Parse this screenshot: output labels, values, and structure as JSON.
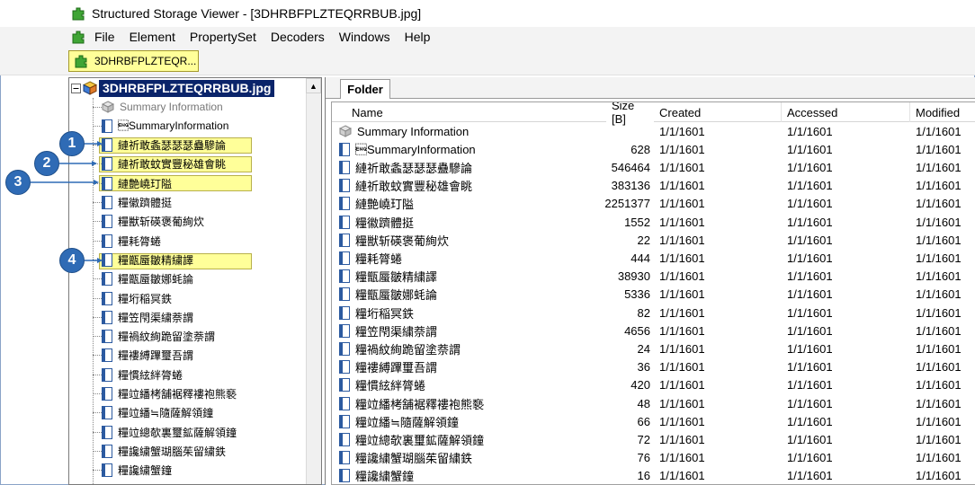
{
  "window": {
    "title": "Structured Storage Viewer - [3DHRBFPLZTEQRRBUB.jpg]"
  },
  "menu": [
    "File",
    "Element",
    "PropertySet",
    "Decoders",
    "Windows",
    "Help"
  ],
  "toolbar": {
    "tree_tab_label": "3DHRBFPLZTEQR..."
  },
  "tree": {
    "root_label": "3DHRBFPLZTEQRRBUB.jpg",
    "items": [
      {
        "label": "Summary Information",
        "gray": true
      },
      {
        "label": "\u0005SummaryInformation",
        "gray": false
      },
      {
        "label": "縺祈敢螽瑟瑟瑟蠱驂論",
        "gray": false
      },
      {
        "label": "縺祈敢蚊實豐秘雄會眺",
        "gray": false
      },
      {
        "label": "縺艶嶢玎隘",
        "gray": false
      },
      {
        "label": "糧徽躋體挺",
        "gray": false
      },
      {
        "label": "糧獣斩碤褒葡絢炊",
        "gray": false
      },
      {
        "label": "糧耗膂蜷",
        "gray": false
      },
      {
        "label": "糧甑蜃皺精繍譯",
        "gray": false
      },
      {
        "label": "糧甑蜃皺娜蚝論",
        "gray": false
      },
      {
        "label": "糧垳稲冥鉄",
        "gray": false
      },
      {
        "label": "糧笠閇渠繍萘謂",
        "gray": false
      },
      {
        "label": "糧禍紋絢跪留塗萘謂",
        "gray": false
      },
      {
        "label": "糧褸縛蹕璽吾謂",
        "gray": false
      },
      {
        "label": "糧慣絃絆膂蜷",
        "gray": false
      },
      {
        "label": "糧竝繙栲舗裾釋褸袍熊褻",
        "gray": false
      },
      {
        "label": "糧竝繙≒隨薩解領鐘",
        "gray": false
      },
      {
        "label": "糧竝總欹裏璽鉱薩解領鐘",
        "gray": false
      },
      {
        "label": "糧讒繍蟹瑚腦茱留繍鉄",
        "gray": false
      },
      {
        "label": "糧讒繍蟹鐘",
        "gray": false
      }
    ]
  },
  "callouts": [
    "1",
    "2",
    "3",
    "4"
  ],
  "right": {
    "tab_label": "Folder",
    "columns": [
      "Name",
      "Size [B]",
      "Created",
      "Accessed",
      "Modified"
    ],
    "rows": [
      {
        "name": "Summary Information",
        "size": "",
        "created": "1/1/1601",
        "accessed": "1/1/1601",
        "modified": "1/1/1601",
        "icon": "cube-icon"
      },
      {
        "name": "\u0005SummaryInformation",
        "size": "628",
        "created": "1/1/1601",
        "accessed": "1/1/1601",
        "modified": "1/1/1601",
        "icon": "document-icon"
      },
      {
        "name": "縺祈敢螽瑟瑟瑟蠱驂論",
        "size": "546464",
        "created": "1/1/1601",
        "accessed": "1/1/1601",
        "modified": "1/1/1601",
        "icon": "document-icon"
      },
      {
        "name": "縺祈敢蚊實豐秘雄會眺",
        "size": "383136",
        "created": "1/1/1601",
        "accessed": "1/1/1601",
        "modified": "1/1/1601",
        "icon": "document-icon"
      },
      {
        "name": "縺艶嶢玎隘",
        "size": "2251377",
        "created": "1/1/1601",
        "accessed": "1/1/1601",
        "modified": "1/1/1601",
        "icon": "document-icon"
      },
      {
        "name": "糧徽躋體挺",
        "size": "1552",
        "created": "1/1/1601",
        "accessed": "1/1/1601",
        "modified": "1/1/1601",
        "icon": "document-icon"
      },
      {
        "name": "糧獣斩碤褒葡絢炊",
        "size": "22",
        "created": "1/1/1601",
        "accessed": "1/1/1601",
        "modified": "1/1/1601",
        "icon": "document-icon"
      },
      {
        "name": "糧耗膂蜷",
        "size": "444",
        "created": "1/1/1601",
        "accessed": "1/1/1601",
        "modified": "1/1/1601",
        "icon": "document-icon"
      },
      {
        "name": "糧甑蜃皺精繍譯",
        "size": "38930",
        "created": "1/1/1601",
        "accessed": "1/1/1601",
        "modified": "1/1/1601",
        "icon": "document-icon"
      },
      {
        "name": "糧甑蜃皺娜蚝論",
        "size": "5336",
        "created": "1/1/1601",
        "accessed": "1/1/1601",
        "modified": "1/1/1601",
        "icon": "document-icon"
      },
      {
        "name": "糧垳稲冥鉄",
        "size": "82",
        "created": "1/1/1601",
        "accessed": "1/1/1601",
        "modified": "1/1/1601",
        "icon": "document-icon"
      },
      {
        "name": "糧笠閇渠繍萘謂",
        "size": "4656",
        "created": "1/1/1601",
        "accessed": "1/1/1601",
        "modified": "1/1/1601",
        "icon": "document-icon"
      },
      {
        "name": "糧禍紋絢跪留塗萘謂",
        "size": "24",
        "created": "1/1/1601",
        "accessed": "1/1/1601",
        "modified": "1/1/1601",
        "icon": "document-icon"
      },
      {
        "name": "糧褸縛蹕璽吾謂",
        "size": "36",
        "created": "1/1/1601",
        "accessed": "1/1/1601",
        "modified": "1/1/1601",
        "icon": "document-icon"
      },
      {
        "name": "糧慣絃絆膂蜷",
        "size": "420",
        "created": "1/1/1601",
        "accessed": "1/1/1601",
        "modified": "1/1/1601",
        "icon": "document-icon"
      },
      {
        "name": "糧竝繙栲舗裾釋褸袍熊褻",
        "size": "48",
        "created": "1/1/1601",
        "accessed": "1/1/1601",
        "modified": "1/1/1601",
        "icon": "document-icon"
      },
      {
        "name": "糧竝繙≒隨薩解領鐘",
        "size": "66",
        "created": "1/1/1601",
        "accessed": "1/1/1601",
        "modified": "1/1/1601",
        "icon": "document-icon"
      },
      {
        "name": "糧竝總欹裏璽鉱薩解領鐘",
        "size": "72",
        "created": "1/1/1601",
        "accessed": "1/1/1601",
        "modified": "1/1/1601",
        "icon": "document-icon"
      },
      {
        "name": "糧讒繍蟹瑚腦茱留繍鉄",
        "size": "76",
        "created": "1/1/1601",
        "accessed": "1/1/1601",
        "modified": "1/1/1601",
        "icon": "document-icon"
      },
      {
        "name": "糧讒繍蟹鐘",
        "size": "16",
        "created": "1/1/1601",
        "accessed": "1/1/1601",
        "modified": "1/1/1601",
        "icon": "document-icon"
      }
    ]
  },
  "colors": {
    "selection": "#0a246a",
    "highlight": "#ffff99",
    "callout": "#2f6bb5",
    "app_icon": "#3fa535"
  }
}
